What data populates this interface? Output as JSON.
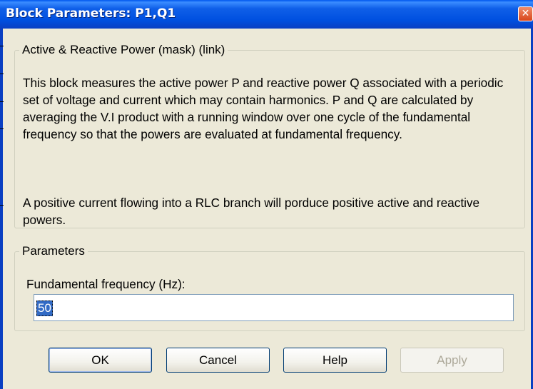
{
  "window": {
    "title": "Block Parameters: P1,Q1",
    "close_glyph": "✕"
  },
  "mask": {
    "legend": "Active & Reactive Power  (mask) (link)",
    "description_p1": "This block measures the active power P and reactive power Q associated with a periodic  set of voltage and current which may contain harmonics. P and Q are calculated by averaging the V.I product with a running window over one cycle of the fundamental frequency so that the powers are evaluated at fundamental frequency.",
    "description_p2": "A positive current flowing into a RLC branch will porduce positive active and reactive powers."
  },
  "parameters": {
    "legend": "Parameters",
    "freq_label": "Fundamental frequency (Hz):",
    "freq_value": "50"
  },
  "buttons": {
    "ok": "OK",
    "cancel": "Cancel",
    "help": "Help",
    "apply": "Apply"
  },
  "icons": {
    "close": "close-icon"
  }
}
